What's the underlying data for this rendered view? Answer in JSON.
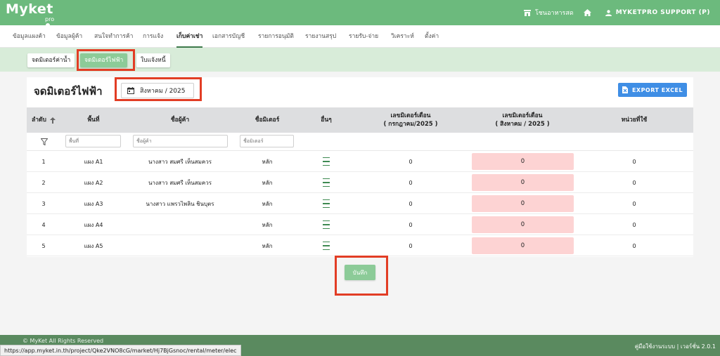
{
  "app": {
    "logo_main": "Myket",
    "logo_sub": "pro"
  },
  "topbar": {
    "store_name": "โชนอาหารสด",
    "user_label": "MYKETPRO SUPPORT (P)"
  },
  "menu": [
    {
      "label": "ข้อมูลแผงค้า"
    },
    {
      "label": "ข้อมูลผู้ค้า"
    },
    {
      "label": "สนใจทำการค้า"
    },
    {
      "label": "การแจ้ง"
    },
    {
      "label": "เก็บค่าเช่า"
    },
    {
      "label": "เอกสารบัญชี"
    },
    {
      "label": "รายการอนุมัติ"
    },
    {
      "label": "รายงานสรุป"
    },
    {
      "label": "รายรับ-จ่าย"
    },
    {
      "label": "วิเคราะห์"
    },
    {
      "label": "ตั้งค่า"
    }
  ],
  "subtabs": [
    {
      "label": "จดมิเตอร์ค่าน้ำ"
    },
    {
      "label": "จดมิเตอร์ไฟฟ้า"
    },
    {
      "label": "ใบแจ้งหนี้"
    }
  ],
  "page": {
    "title": "จดมิเตอร์ไฟฟ้า",
    "month": "สิงหาคม / 2025",
    "export_label": "EXPORT EXCEL",
    "save_label": "บันทึก"
  },
  "table": {
    "headers": {
      "no": "ลำดับ",
      "area": "พื้นที่",
      "vendor": "ชื่อผู้ค้า",
      "meter": "ชื่อมิเตอร์",
      "other": "อื่นๆ",
      "prev_line1": "เลขมิเตอร์เดือน",
      "prev_line2": "( กรกฎาคม/2025 )",
      "curr_line1": "เลขมิเตอร์เดือน",
      "curr_line2": "( สิงหาคม / 2025 )",
      "units": "หน่วยที่ใช้"
    },
    "filters": {
      "area": "พื้นที่",
      "vendor": "ชื่อผู้ค้า",
      "meter": "ชื่อมิเตอร์"
    },
    "rows": [
      {
        "no": "1",
        "area": "แผง A1",
        "vendor": "นางสาว สมศรี เห็นสมควร",
        "meter": "หลัก",
        "prev": "0",
        "curr": "0",
        "units": "0"
      },
      {
        "no": "2",
        "area": "แผง A2",
        "vendor": "นางสาว สมศรี เห็นสมควร",
        "meter": "หลัก",
        "prev": "0",
        "curr": "0",
        "units": "0"
      },
      {
        "no": "3",
        "area": "แผง A3",
        "vendor": "นางสาว แพรวไพลิน ชินบุตร",
        "meter": "หลัก",
        "prev": "0",
        "curr": "0",
        "units": "0"
      },
      {
        "no": "4",
        "area": "แผง A4",
        "vendor": "",
        "meter": "หลัก",
        "prev": "0",
        "curr": "0",
        "units": "0"
      },
      {
        "no": "5",
        "area": "แผง A5",
        "vendor": "",
        "meter": "หลัก",
        "prev": "0",
        "curr": "0",
        "units": "0"
      }
    ]
  },
  "footer": {
    "copyright": "© MyKet All Rights Reserved",
    "right": "คู่มือใช้งานระบบ | เวอร์ชั่น 2.0.1"
  },
  "status_url": "https://app.myket.in.th/project/Qke2VNO8cG/market/Hj7BjGsnoc/rental/meter/elec"
}
